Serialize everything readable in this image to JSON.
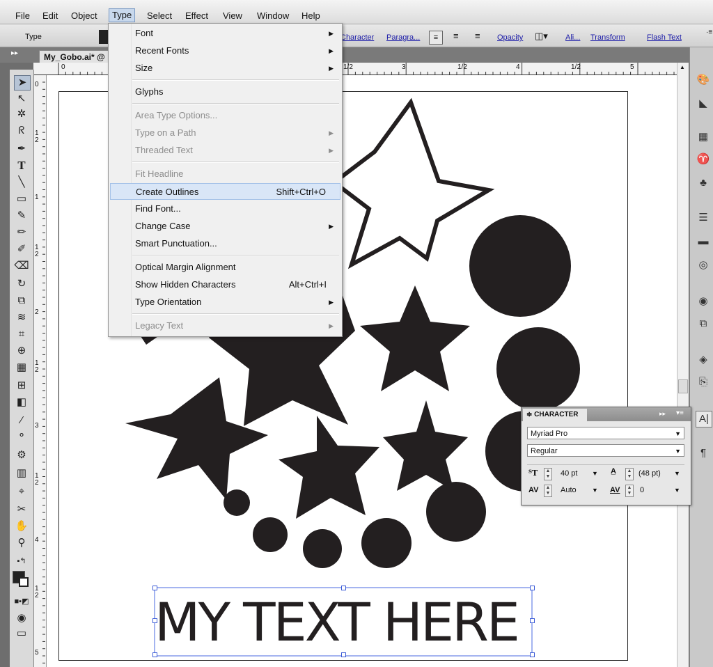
{
  "menubar": {
    "items": [
      "File",
      "Edit",
      "Object",
      "Type",
      "Select",
      "Effect",
      "View",
      "Window",
      "Help"
    ],
    "active": "Type"
  },
  "controlbar": {
    "type_label": "Type",
    "links": [
      "Character",
      "Paragra...",
      "Opacity",
      "Ali...",
      "Transform",
      "Flash Text"
    ]
  },
  "document": {
    "tab_title": "My_Gobo.ai* @"
  },
  "rulers": {
    "h_labels": [
      "0",
      "1/2",
      "3",
      "1/2",
      "4",
      "1/2",
      "5"
    ],
    "v_labels": [
      "0",
      "1",
      "2",
      "1",
      "1",
      "2",
      "2",
      "1",
      "2",
      "3",
      "1",
      "2",
      "4",
      "1",
      "2",
      "5"
    ]
  },
  "type_menu": {
    "items": [
      {
        "label": "Font",
        "submenu": true
      },
      {
        "label": "Recent Fonts",
        "submenu": true
      },
      {
        "label": "Size",
        "submenu": true
      },
      {
        "label": "Glyphs"
      },
      {
        "label": "Area Type Options...",
        "disabled": true
      },
      {
        "label": "Type on a Path",
        "disabled": true,
        "submenu": true
      },
      {
        "label": "Threaded Text",
        "disabled": true,
        "submenu": true
      },
      {
        "label": "Fit Headline",
        "disabled": true
      },
      {
        "label": "Create Outlines",
        "shortcut": "Shift+Ctrl+O",
        "highlighted": true
      },
      {
        "label": "Find Font..."
      },
      {
        "label": "Change Case",
        "submenu": true
      },
      {
        "label": "Smart Punctuation..."
      },
      {
        "label": "Optical Margin Alignment"
      },
      {
        "label": "Show Hidden Characters",
        "shortcut": "Alt+Ctrl+I"
      },
      {
        "label": "Type Orientation",
        "submenu": true
      },
      {
        "label": "Legacy Text",
        "disabled": true,
        "submenu": true
      }
    ]
  },
  "artboard": {
    "text": "MY TEXT HERE",
    "fill_color": "#231f20"
  },
  "character_panel": {
    "title": "CHARACTER",
    "font_family": "Myriad Pro",
    "font_style": "Regular",
    "font_size": "40 pt",
    "leading": "(48 pt)",
    "kerning": "Auto",
    "tracking": "0"
  },
  "colors": {
    "highlight": "#d9e6f7",
    "link": "#1a1aa8"
  }
}
